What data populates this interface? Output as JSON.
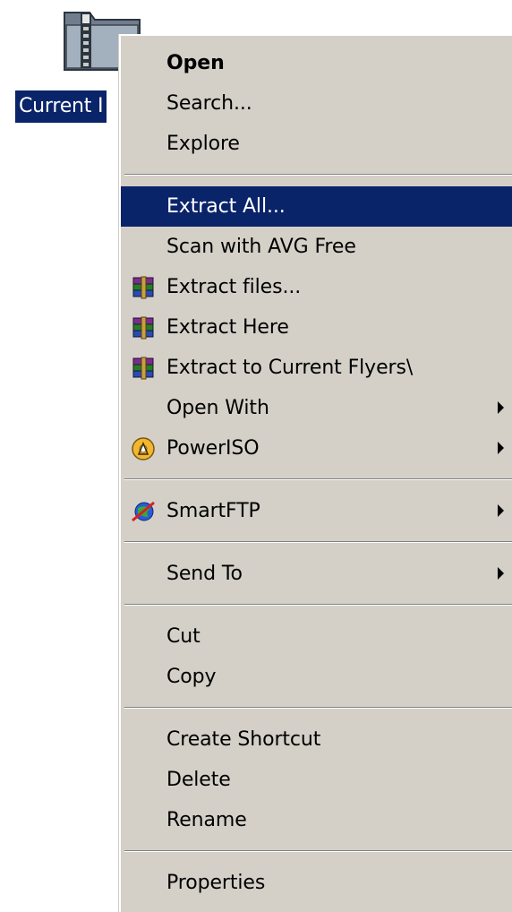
{
  "desktop_icon": {
    "label": "Current I",
    "icon": "zip-folder-icon"
  },
  "colors": {
    "menu_background": "#d4d0c8",
    "highlight": "#0a246a",
    "highlight_text": "#ffffff"
  },
  "context_menu": {
    "groups": [
      [
        {
          "label": "Open",
          "bold": true
        },
        {
          "label": "Search..."
        },
        {
          "label": "Explore"
        }
      ],
      [
        {
          "label": "Extract All...",
          "highlighted": true
        },
        {
          "label": "Scan with AVG Free"
        },
        {
          "label": "Extract files...",
          "icon": "winrar-icon"
        },
        {
          "label": "Extract Here",
          "icon": "winrar-icon"
        },
        {
          "label": "Extract to Current Flyers\\",
          "icon": "winrar-icon"
        },
        {
          "label": "Open With",
          "submenu": true
        },
        {
          "label": "PowerISO",
          "icon": "poweriso-icon",
          "submenu": true
        }
      ],
      [
        {
          "label": "SmartFTP",
          "icon": "smartftp-icon",
          "submenu": true
        }
      ],
      [
        {
          "label": "Send To",
          "submenu": true
        }
      ],
      [
        {
          "label": "Cut"
        },
        {
          "label": "Copy"
        }
      ],
      [
        {
          "label": "Create Shortcut"
        },
        {
          "label": "Delete"
        },
        {
          "label": "Rename"
        }
      ],
      [
        {
          "label": "Properties"
        }
      ]
    ]
  }
}
